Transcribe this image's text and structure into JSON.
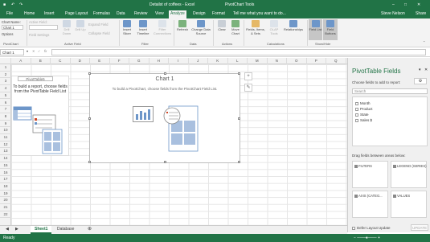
{
  "window": {
    "doc_title": "Detailst of coffees - Excel",
    "context_title": "PivotChart Tools",
    "user": "Steve Nelson"
  },
  "tabs": [
    "File",
    "Home",
    "Insert",
    "Page Layout",
    "Formulas",
    "Data",
    "Review",
    "View",
    "Analyze",
    "Design",
    "Format"
  ],
  "tell_me": "Tell me what you want to do...",
  "share": "Share",
  "ribbon": {
    "chart_name_label": "Chart Name:",
    "chart_name_value": "Chart 1",
    "options_label": "Options",
    "active_field_label": "Active Field:",
    "field_settings_label": "Field Settings",
    "drill_down_label": "Drill Down",
    "drill_up_label": "Drill Up",
    "expand_field_label": "Expand Field",
    "collapse_field_label": "Collapse Field",
    "insert_slicer_label": "Insert Slicer",
    "insert_timeline_label": "Insert Timeline",
    "filter_connections_label": "Filter Connections",
    "refresh_label": "Refresh",
    "change_data_source_label": "Change Data Source",
    "clear_label": "Clear",
    "move_chart_label": "Move Chart",
    "fields_items_sets_label": "Fields, Items, & Sets",
    "olap_tools_label": "OLAP Tools",
    "relationships_label": "Relationships",
    "field_list_label": "Field List",
    "field_buttons_label": "Field Buttons",
    "groups": [
      "PivotChart",
      "Active Field",
      "Filter",
      "Data",
      "Actions",
      "Calculations",
      "Show/Hide"
    ]
  },
  "namebox": "Chart 1",
  "columns": [
    "A",
    "B",
    "C",
    "D",
    "E",
    "F",
    "G",
    "H",
    "I",
    "J",
    "K",
    "L",
    "M",
    "N",
    "O",
    "P",
    "Q"
  ],
  "rows": [
    "1",
    "2",
    "3",
    "4",
    "5",
    "6",
    "7",
    "8",
    "9",
    "10",
    "11",
    "12",
    "13",
    "14",
    "15",
    "16",
    "17",
    "18",
    "19",
    "20",
    "21",
    "22"
  ],
  "pivot_placeholder": {
    "name": "PivotTable5",
    "message": "To build a report, choose fields from the PivotTable Field List"
  },
  "chart": {
    "title": "Chart 1",
    "message": "To build a PivotChart, choose fields from the PivotChart Field List."
  },
  "pane": {
    "title": "PivotTable Fields",
    "choose_label": "Choose fields to add to report:",
    "search_placeholder": "Search",
    "fields": [
      "Month",
      "Product",
      "State",
      "Sales $"
    ],
    "areas_label": "Drag fields between areas below:",
    "areas": [
      "FILTERS",
      "LEGEND (SERIES)",
      "AXIS (CATEG...",
      "VALUES"
    ],
    "defer_label": "Defer Layout Update",
    "update_label": "UPDATE"
  },
  "sheets": [
    "Sheet1",
    "Database"
  ],
  "status": "Ready",
  "colors": {
    "excel_green": "#217346"
  }
}
